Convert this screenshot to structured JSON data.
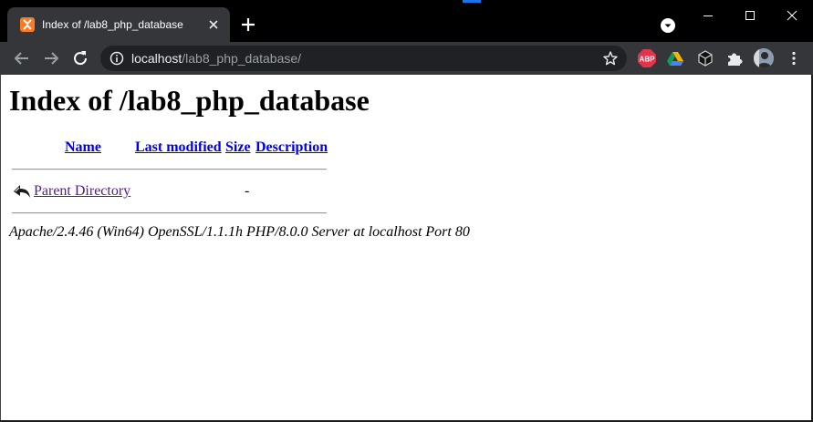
{
  "browser": {
    "tab": {
      "title": "Index of /lab8_php_database"
    },
    "address_bar": {
      "host": "localhost",
      "path": "/lab8_php_database/"
    },
    "extensions": {
      "adblock_label": "ABP"
    },
    "colors": {
      "titlebar": "#000000",
      "toolbar": "#35363a",
      "omnibox": "#202124",
      "xampp_orange": "#fb7a24",
      "abp_red": "#e3344d"
    },
    "icons": [
      "xampp-favicon",
      "close-icon",
      "plus-icon",
      "tab-search-icon",
      "minimize-icon",
      "maximize-icon",
      "close-window-icon",
      "back-arrow-icon",
      "forward-arrow-icon",
      "reload-icon",
      "info-icon",
      "star-icon",
      "adblock-icon",
      "drive-extension-icon",
      "cube-extension-icon",
      "puzzle-icon",
      "avatar",
      "menu-dots-icon"
    ]
  },
  "page": {
    "heading": "Index of /lab8_php_database",
    "table": {
      "headers": {
        "name": "Name",
        "last_modified": "Last modified",
        "size": "Size",
        "description": "Description"
      },
      "rows": [
        {
          "name": "Parent Directory",
          "last_modified": "",
          "size": "-",
          "description": ""
        }
      ]
    },
    "footer": "Apache/2.4.46 (Win64) OpenSSL/1.1.1h PHP/8.0.0 Server at localhost Port 80",
    "colors": {
      "link": "#0000ee",
      "visited_link": "#551a8b"
    }
  }
}
